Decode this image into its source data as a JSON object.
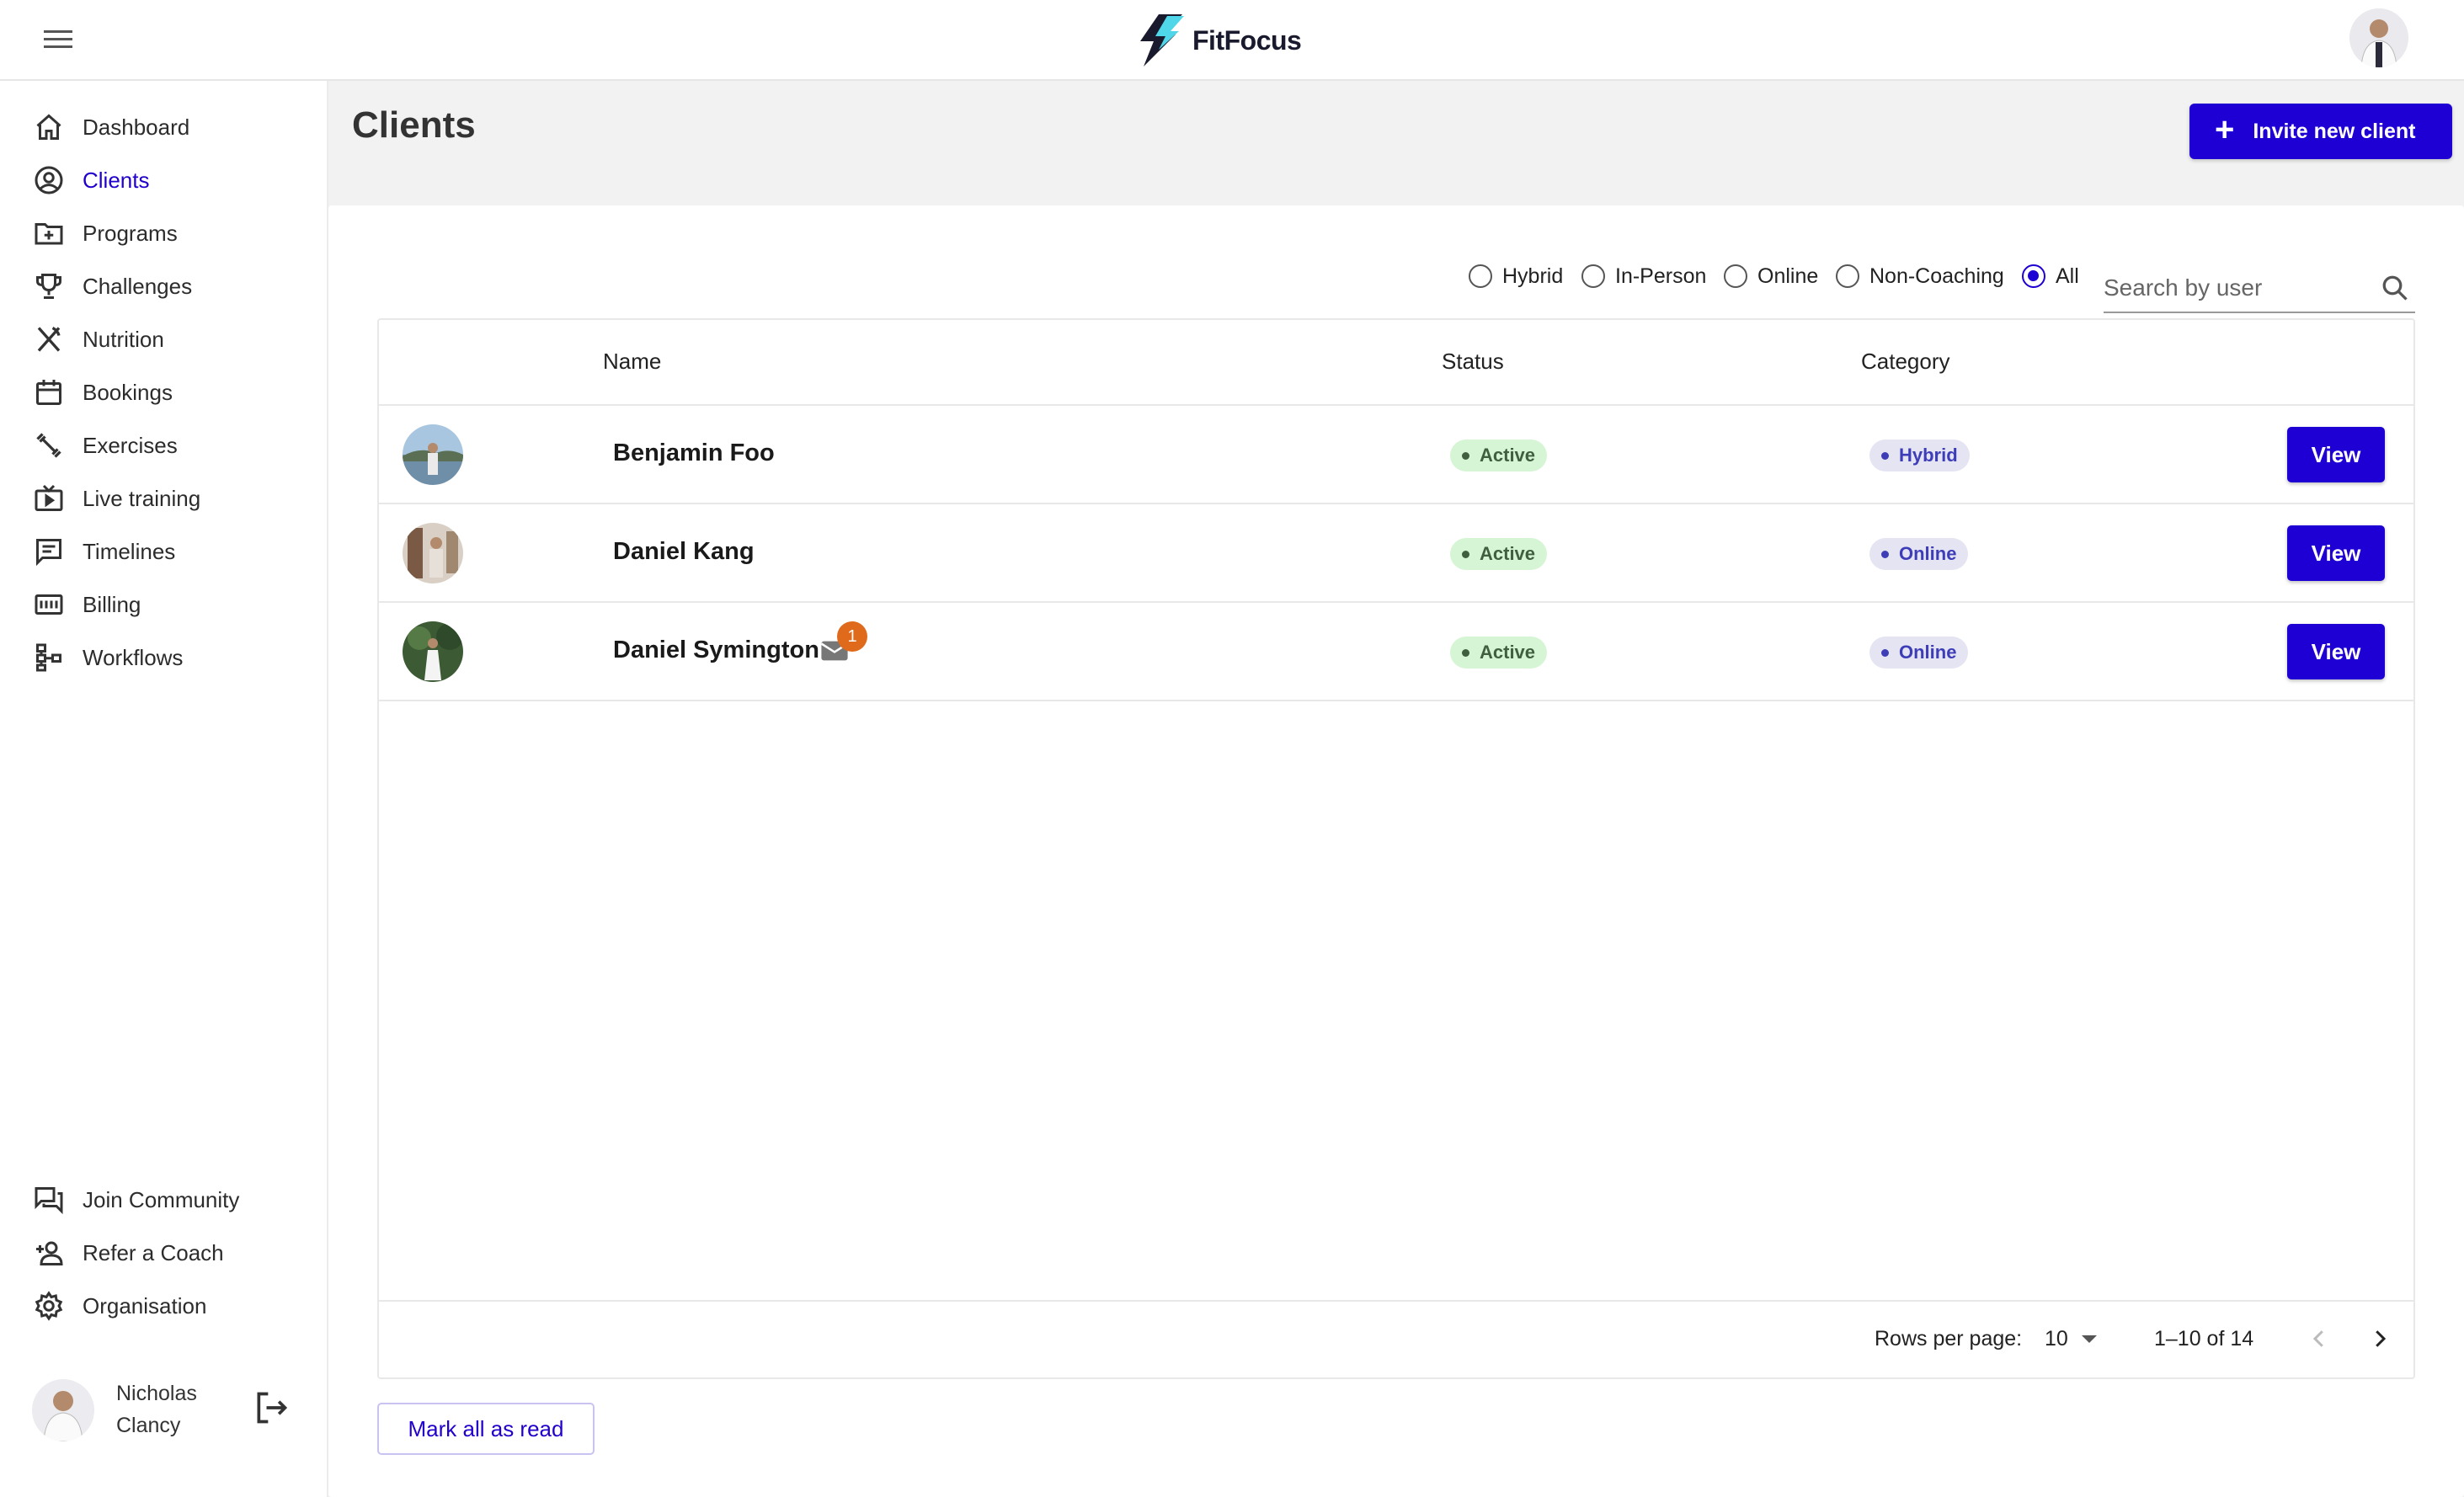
{
  "app": {
    "name": "FitFocus"
  },
  "sidebar": {
    "items": [
      {
        "label": "Dashboard",
        "icon": "home-icon"
      },
      {
        "label": "Clients",
        "icon": "account-circle-icon",
        "active": true
      },
      {
        "label": "Programs",
        "icon": "folder-plus-icon"
      },
      {
        "label": "Challenges",
        "icon": "trophy-icon"
      },
      {
        "label": "Nutrition",
        "icon": "fork-knife-icon"
      },
      {
        "label": "Bookings",
        "icon": "calendar-icon"
      },
      {
        "label": "Exercises",
        "icon": "dumbbell-icon"
      },
      {
        "label": "Live training",
        "icon": "live-tv-icon"
      },
      {
        "label": "Timelines",
        "icon": "comment-icon"
      },
      {
        "label": "Billing",
        "icon": "billing-icon"
      },
      {
        "label": "Workflows",
        "icon": "workflow-icon"
      }
    ],
    "bottom_items": [
      {
        "label": "Join Community",
        "icon": "forum-icon"
      },
      {
        "label": "Refer a Coach",
        "icon": "person-add-icon"
      },
      {
        "label": "Organisation",
        "icon": "gear-icon"
      }
    ],
    "user": {
      "name": "Nicholas Clancy"
    }
  },
  "main": {
    "title": "Clients",
    "invite_label": "Invite new client",
    "filters": [
      {
        "label": "Hybrid",
        "selected": false
      },
      {
        "label": "In-Person",
        "selected": false
      },
      {
        "label": "Online",
        "selected": false
      },
      {
        "label": "Non-Coaching",
        "selected": false
      },
      {
        "label": "All",
        "selected": true
      }
    ],
    "search_placeholder": "Search by user",
    "columns": [
      "Name",
      "Status",
      "Category"
    ],
    "rows": [
      {
        "name": "Benjamin Foo",
        "status": "Active",
        "category": "Hybrid",
        "action": "View",
        "unread": null
      },
      {
        "name": "Daniel Kang",
        "status": "Active",
        "category": "Online",
        "action": "View",
        "unread": null
      },
      {
        "name": "Daniel Symington",
        "status": "Active",
        "category": "Online",
        "action": "View",
        "unread": "1"
      }
    ],
    "pagination": {
      "rows_per_page_label": "Rows per page:",
      "rows_per_page": "10",
      "range": "1–10 of 14"
    },
    "mark_all_label": "Mark all as read"
  },
  "colors": {
    "accent": "#1f00d4",
    "active_chip": "#d6f5d4",
    "category_chip": "#e4e4f3",
    "badge": "#e06a1c"
  }
}
